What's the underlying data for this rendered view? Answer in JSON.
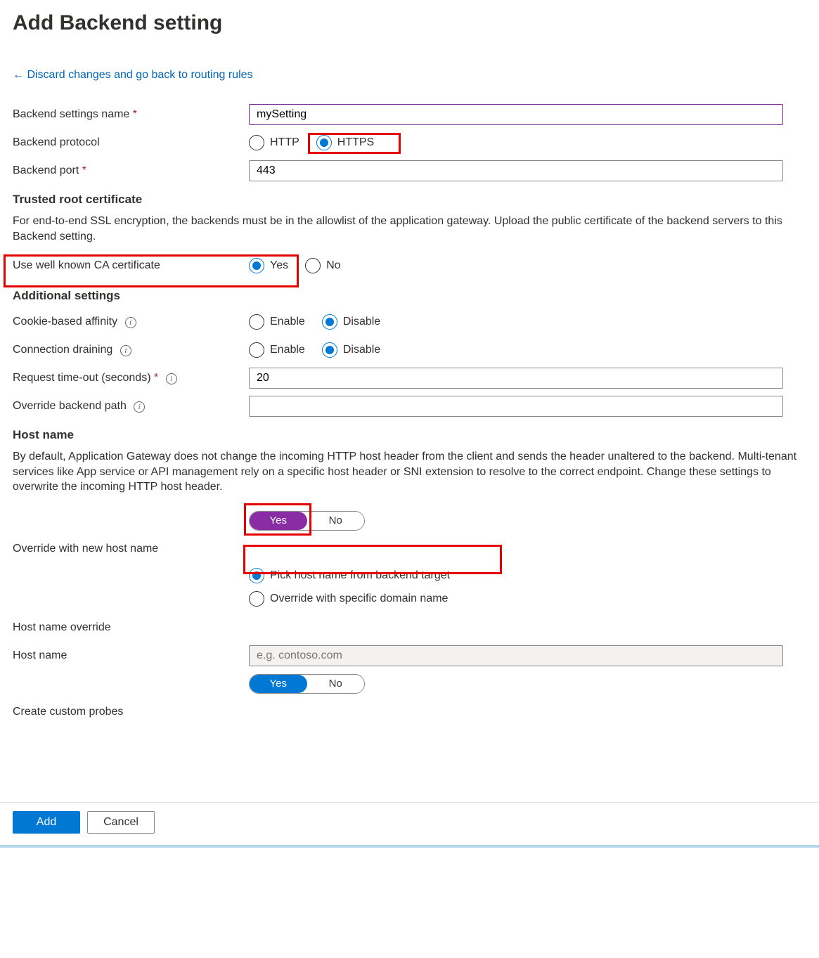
{
  "title": "Add Backend setting",
  "back_link": "← Discard changes and go back to routing rules",
  "fields": {
    "name_label": "Backend settings name",
    "name_value": "mySetting",
    "protocol_label": "Backend protocol",
    "protocol_http": "HTTP",
    "protocol_https": "HTTPS",
    "port_label": "Backend port",
    "port_value": "443"
  },
  "trusted": {
    "heading": "Trusted root certificate",
    "desc": "For end-to-end SSL encryption, the backends must be in the allowlist of the application gateway. Upload the public certificate of the backend servers to this Backend setting.",
    "ca_label": "Use well known CA certificate",
    "yes": "Yes",
    "no": "No"
  },
  "additional": {
    "heading": "Additional settings",
    "cookie_label": "Cookie-based affinity",
    "drain_label": "Connection draining",
    "enable": "Enable",
    "disable": "Disable",
    "timeout_label": "Request time-out (seconds)",
    "timeout_value": "20",
    "override_path_label": "Override backend path",
    "override_path_value": ""
  },
  "hostname": {
    "heading": "Host name",
    "desc": "By default, Application Gateway does not change the incoming HTTP host header from the client and sends the header unaltered to the backend. Multi-tenant services like App service or API management rely on a specific host header or SNI extension to resolve to the correct endpoint. Change these settings to overwrite the incoming HTTP host header.",
    "yes": "Yes",
    "no": "No",
    "override_label": "Override with new host name",
    "pick_label": "Pick host name from backend target",
    "specific_label": "Override with specific domain name",
    "host_override_label": "Host name override",
    "host_name_label": "Host name",
    "host_placeholder": "e.g. contoso.com",
    "probes_label": "Create custom probes"
  },
  "footer": {
    "add": "Add",
    "cancel": "Cancel"
  }
}
